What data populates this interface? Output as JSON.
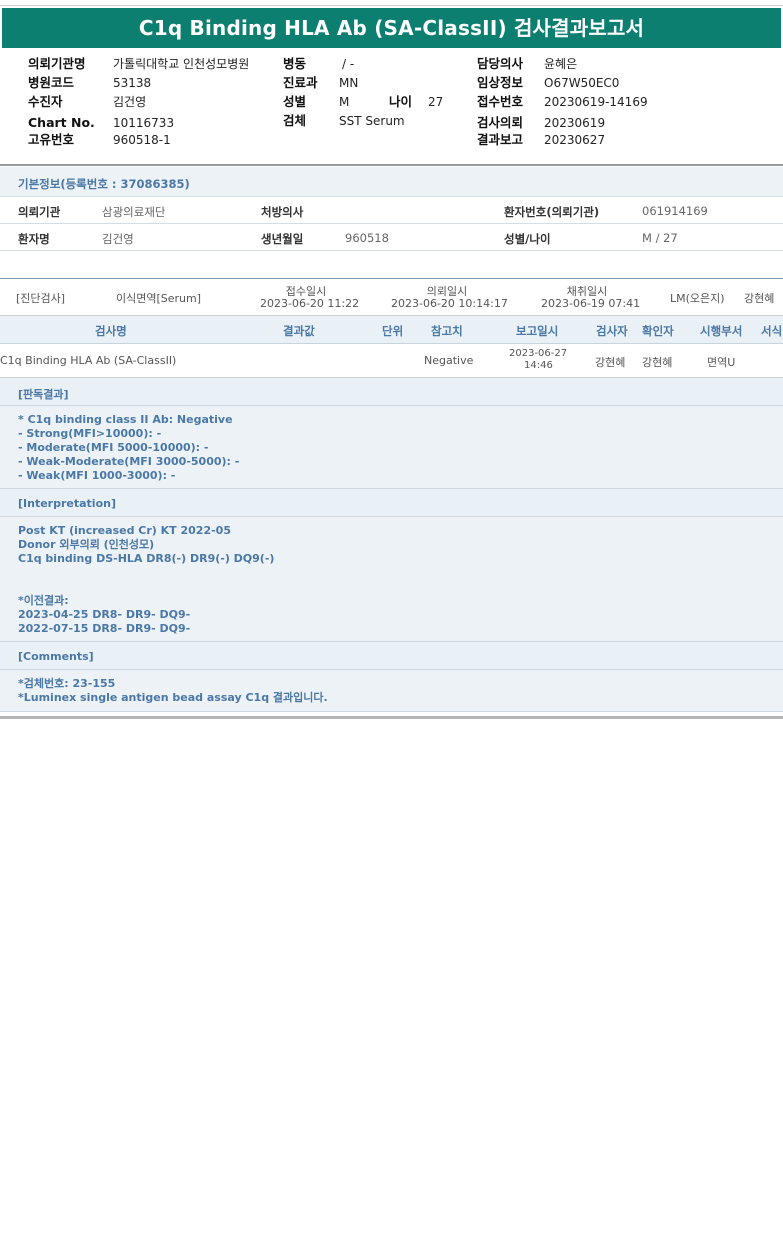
{
  "report": {
    "title": "C1q Binding HLA Ab (SA-ClassII) 검사결과보고서"
  },
  "header": {
    "institution_label": "의뢰기관명",
    "institution_value": "가톨릭대학교 인천성모병원",
    "hospital_code_label": "병원코드",
    "hospital_code_value": "53138",
    "examinee_label": "수진자",
    "examinee_value": "김건영",
    "chart_no_label": "Chart No.",
    "chart_no_value": "10116733",
    "unique_no_label": "고유번호",
    "unique_no_value": "960518-1",
    "ward_label": "병동",
    "ward_value": "/ -",
    "department_label": "진료과",
    "department_value": "MN",
    "sex_label": "성별",
    "sex_value": "M",
    "age_label": "나이",
    "age_value": "27",
    "specimen_label": "검체",
    "specimen_value": "SST Serum",
    "doctor_label": "담당의사",
    "doctor_value": "윤혜은",
    "clinical_info_label": "임상정보",
    "clinical_info_value": "O67W50EC0",
    "receipt_no_label": "접수번호",
    "receipt_no_value": "20230619-14169",
    "request_date_label": "검사의뢰",
    "request_date_value": "20230619",
    "report_date_label": "결과보고",
    "report_date_value": "20230627"
  },
  "basic_info": {
    "section_title": "기본정보(등록번호 : 37086385)",
    "requester_org_label": "의뢰기관",
    "requester_org_value": "삼광의료재단",
    "prescriber_label": "처방의사",
    "prescriber_value": "",
    "patient_no_label": "환자번호(의뢰기관)",
    "patient_no_value": "061914169",
    "patient_name_label": "환자명",
    "patient_name_value": "김건영",
    "birth_label": "생년월일",
    "birth_value": "960518",
    "sex_age_label": "성별/나이",
    "sex_age_value": "M / 27"
  },
  "order": {
    "category": "[진단검사]",
    "department": "이식면역[Serum]",
    "receipt_label": "접수일시",
    "receipt_value": "2023-06-20 11:22",
    "request_label": "의뢰일시",
    "request_value": "2023-06-20 10:14:17",
    "collect_label": "채취일시",
    "collect_value": "2023-06-19 07:41",
    "lm": "LM(오은지)",
    "tester": "강현혜"
  },
  "results_table": {
    "columns": [
      "검사명",
      "결과값",
      "단위",
      "참고치",
      "보고일시",
      "검사자",
      "확인자",
      "시행부서",
      "서식"
    ],
    "rows": [
      {
        "test_name": "C1q Binding HLA Ab (SA-ClassII)",
        "result": "",
        "unit": "",
        "reference": "Negative",
        "report_date": "2023-06-27",
        "report_time": "14:46",
        "tester": "강현혜",
        "verifier": "강현혜",
        "department": "면역U",
        "form": ""
      }
    ]
  },
  "judgement": {
    "title": "[판독결과]",
    "lines": [
      "* C1q binding class II Ab: Negative",
      "- Strong(MFI>10000): -",
      "- Moderate(MFI 5000-10000): -",
      "- Weak-Moderate(MFI 3000-5000): -",
      "- Weak(MFI 1000-3000): -"
    ]
  },
  "interpretation": {
    "title": "[Interpretation]",
    "lines": [
      "Post KT (increased Cr) KT 2022-05",
      "Donor 외부의뢰 (인천성모)",
      "C1q binding DS-HLA DR8(-) DR9(-) DQ9(-)",
      "",
      "",
      "*이전결과:",
      "2023-04-25 DR8- DR9- DQ9-",
      "2022-07-15 DR8- DR9- DQ9-"
    ]
  },
  "comments": {
    "title": "[Comments]",
    "lines": [
      "*검체번호: 23-155",
      "*Luminex single antigen bead assay C1q 결과입니다."
    ]
  }
}
